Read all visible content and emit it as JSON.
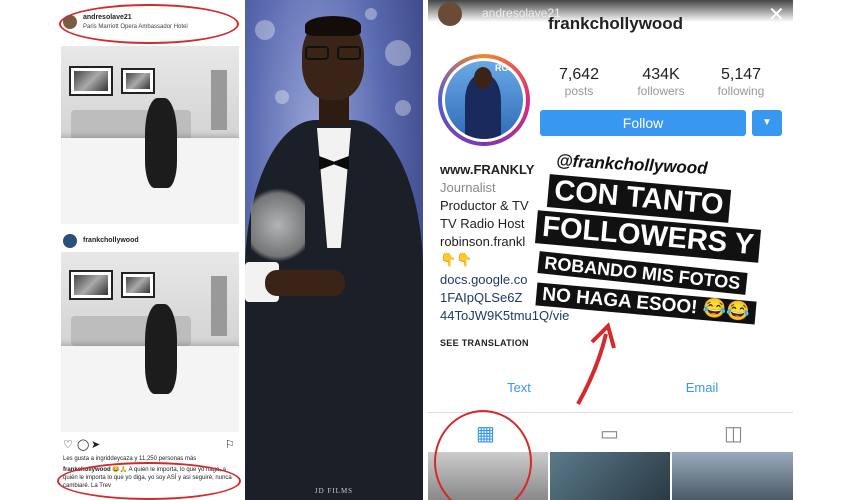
{
  "left": {
    "post1": {
      "username": "andresolave21",
      "location": "Paris Marriott Opera Ambassador Hotel"
    },
    "post2": {
      "username": "frankchollywood"
    },
    "likes_text": "Les gusta a ingriddeycaza y 11,250 personas más",
    "caption_user": "frankchollywood",
    "caption_text": "😂🙏 A quién le importa, lo que yo haga, a quién le importa lo que yo diga, yo soy ASÍ y así seguiré, nunca cambiaré. La Trev"
  },
  "middle": {
    "credit": "JD FILMS"
  },
  "right": {
    "story_user": "andresolave21",
    "handle": "frankchollywood",
    "profile_tag": "ROBINSON",
    "stats": [
      {
        "value": "7,642",
        "label": "posts"
      },
      {
        "value": "434K",
        "label": "followers"
      },
      {
        "value": "5,147",
        "label": "following"
      }
    ],
    "follow_label": "Follow",
    "dropdown_icon": "chevron-down-icon",
    "bio": {
      "site": "www.FRANKLY",
      "role": "Journalist",
      "line1": "Productor & TV",
      "line2": "TV Radio Host",
      "line3": "robinson.frankl",
      "emoji": "👇👇",
      "link1": "docs.google.co",
      "link2": "1FAIpQLSe6Z",
      "link3": "44ToJW9K5tmu1Q/vie"
    },
    "see_translation": "SEE TRANSLATION",
    "contact": {
      "text_label": "Text",
      "email_label": "Email"
    },
    "stickers": {
      "mention": "@frankchollywood",
      "line1": "CON TANTO",
      "line2": "FOLLOWERS Y",
      "line3": "ROBANDO MIS FOTOS",
      "line4": "NO HAGA ESOO! 😂😂"
    },
    "accent": "#3897f0",
    "annotation_color": "#d42a2a"
  }
}
